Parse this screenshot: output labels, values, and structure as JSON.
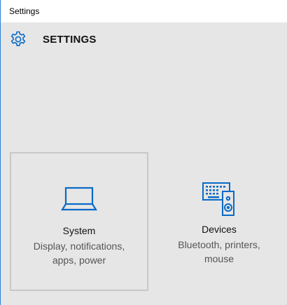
{
  "window": {
    "title": "Settings"
  },
  "header": {
    "heading": "SETTINGS",
    "icon": "gear-icon"
  },
  "tiles": [
    {
      "name": "System",
      "desc_line1": "Display, notifications,",
      "desc_line2": "apps, power",
      "icon": "laptop-icon",
      "selected": true
    },
    {
      "name": "Devices",
      "desc_line1": "Bluetooth, printers,",
      "desc_line2": "mouse",
      "icon": "devices-icon",
      "selected": false
    }
  ],
  "colors": {
    "accent": "#0a6ac7",
    "background": "#e6e6e6",
    "titlebar": "#ffffff",
    "tile_border": "#c8c8c8"
  }
}
